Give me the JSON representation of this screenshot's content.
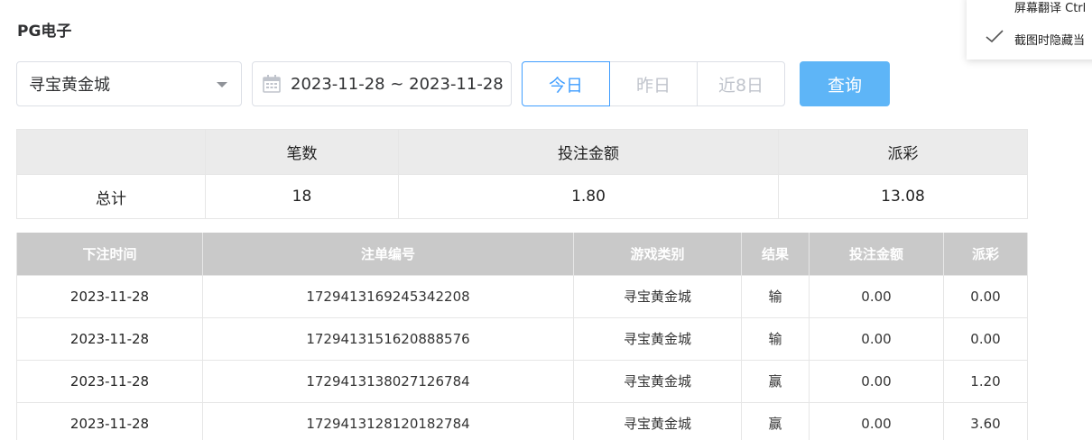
{
  "page": {
    "title": "PG电子"
  },
  "filters": {
    "game": "寻宝黄金城",
    "date_range": "2023-11-28 ~ 2023-11-28",
    "quick": [
      "今日",
      "昨日",
      "近8日"
    ],
    "query": "查询"
  },
  "context_menu": {
    "item1": "屏幕翻译 Ctrl",
    "item2": "截图时隐藏当"
  },
  "summary": {
    "headers": [
      "",
      "笔数",
      "投注金额",
      "派彩"
    ],
    "row": [
      "总计",
      "18",
      "1.80",
      "13.08"
    ]
  },
  "detail": {
    "headers": [
      "下注时间",
      "注单编号",
      "游戏类别",
      "结果",
      "投注金额",
      "派彩"
    ],
    "rows": [
      [
        "2023-11-28",
        "1729413169245342208",
        "寻宝黄金城",
        "输",
        "0.00",
        "0.00"
      ],
      [
        "2023-11-28",
        "1729413151620888576",
        "寻宝黄金城",
        "输",
        "0.00",
        "0.00"
      ],
      [
        "2023-11-28",
        "1729413138027126784",
        "寻宝黄金城",
        "赢",
        "0.00",
        "1.20"
      ],
      [
        "2023-11-28",
        "1729413128120182784",
        "寻宝黄金城",
        "赢",
        "0.00",
        "3.60"
      ]
    ]
  },
  "colors": {
    "primary": "#409eff",
    "query_bg": "#5eb5f7",
    "table_header_bg": "#c9c9c9",
    "summary_header_bg": "#ebebeb"
  },
  "icons": {
    "date": "calendar-icon",
    "select": "caret-down-icon",
    "menu_check": "check-icon"
  }
}
